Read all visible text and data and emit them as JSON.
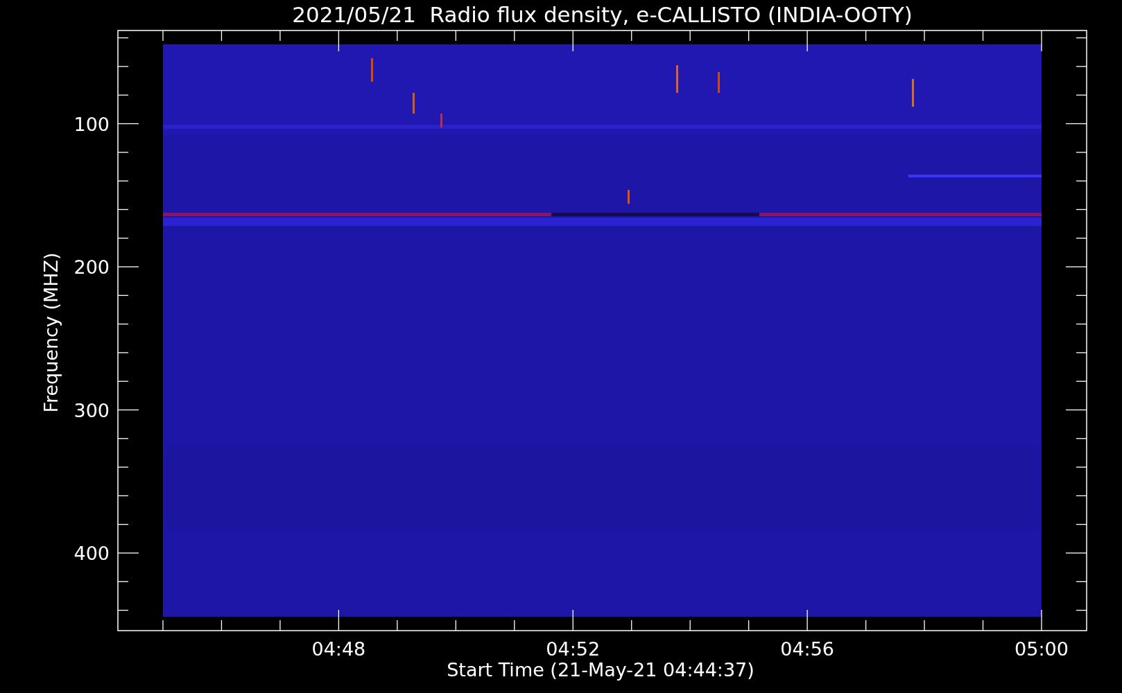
{
  "title": "2021/05/21  Radio flux density, e-CALLISTO (INDIA-OOTY)",
  "y_axis": {
    "label": "Frequency (MHZ)",
    "tick_labels": [
      "100",
      "200",
      "300",
      "400"
    ]
  },
  "x_axis": {
    "label": "Start Time (21-May-21 04:44:37)",
    "tick_labels": [
      "04:48",
      "04:52",
      "04:56",
      "05:00"
    ]
  }
}
